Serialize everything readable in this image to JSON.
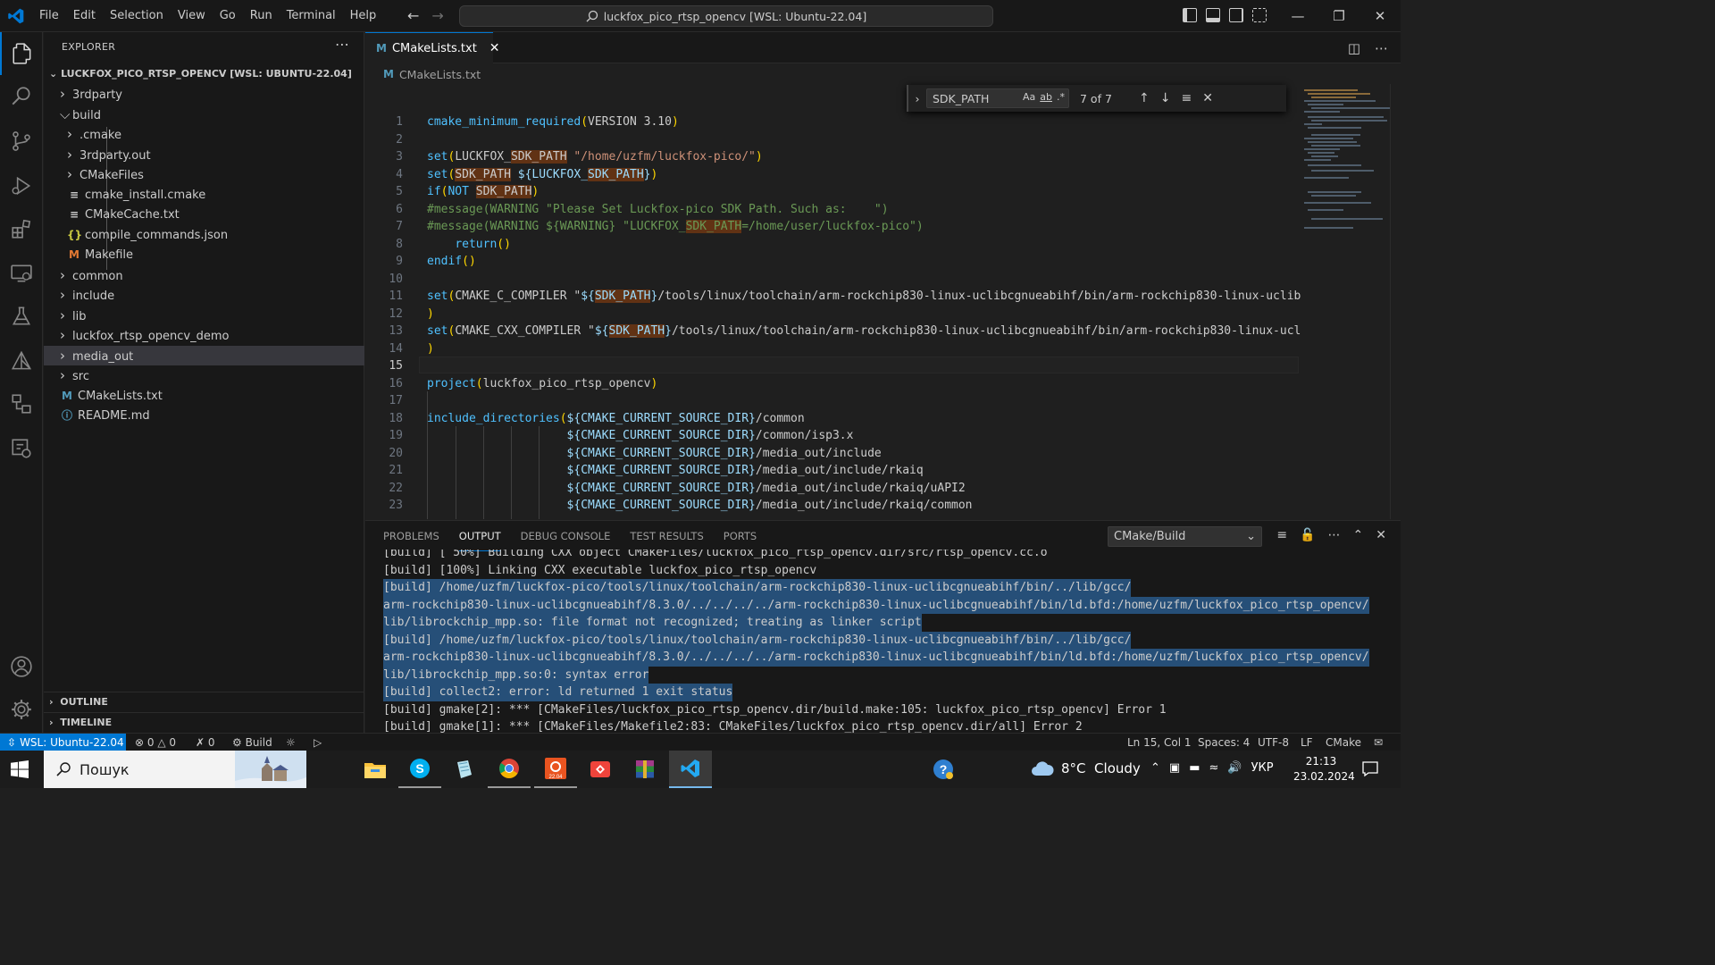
{
  "titlebar": {
    "menu": [
      "File",
      "Edit",
      "Selection",
      "View",
      "Go",
      "Run",
      "Terminal",
      "Help"
    ],
    "command_center": "luckfox_pico_rtsp_opencv [WSL: Ubuntu-22.04]",
    "window_buttons": [
      "minimize-icon",
      "restore-icon",
      "close-icon"
    ]
  },
  "explorer": {
    "title": "EXPLORER",
    "root": "LUCKFOX_PICO_RTSP_OPENCV [WSL: UBUNTU-22.04]",
    "items": [
      {
        "label": "3rdparty",
        "kind": "folder",
        "depth": 0,
        "expanded": false
      },
      {
        "label": "build",
        "kind": "folder",
        "depth": 0,
        "expanded": true
      },
      {
        "label": ".cmake",
        "kind": "folder",
        "depth": 1,
        "expanded": false
      },
      {
        "label": "3rdparty.out",
        "kind": "folder",
        "depth": 1,
        "expanded": false
      },
      {
        "label": "CMakeFiles",
        "kind": "folder",
        "depth": 1,
        "expanded": false
      },
      {
        "label": "cmake_install.cmake",
        "kind": "lines",
        "depth": 1
      },
      {
        "label": "CMakeCache.txt",
        "kind": "lines",
        "depth": 1
      },
      {
        "label": "compile_commands.json",
        "kind": "json",
        "depth": 1
      },
      {
        "label": "Makefile",
        "kind": "makefile",
        "depth": 1
      },
      {
        "label": "common",
        "kind": "folder",
        "depth": 0,
        "expanded": false
      },
      {
        "label": "include",
        "kind": "folder",
        "depth": 0,
        "expanded": false
      },
      {
        "label": "lib",
        "kind": "folder",
        "depth": 0,
        "expanded": false
      },
      {
        "label": "luckfox_rtsp_opencv_demo",
        "kind": "folder",
        "depth": 0,
        "expanded": false
      },
      {
        "label": "media_out",
        "kind": "folder",
        "depth": 0,
        "expanded": false,
        "selected": true
      },
      {
        "label": "src",
        "kind": "folder",
        "depth": 0,
        "expanded": false
      },
      {
        "label": "CMakeLists.txt",
        "kind": "cmake",
        "depth": 0
      },
      {
        "label": "README.md",
        "kind": "info",
        "depth": 0
      }
    ],
    "outline": "OUTLINE",
    "timeline": "TIMELINE"
  },
  "editor": {
    "tab_label": "CMakeLists.txt",
    "breadcrumb": "CMakeLists.txt",
    "find": {
      "query": "SDK_PATH",
      "options": [
        "Aa",
        "ab",
        ".*"
      ],
      "count": "7 of 7"
    },
    "current_line": 15,
    "line_numbers": [
      "1",
      "2",
      "3",
      "4",
      "5",
      "6",
      "7",
      "8",
      "9",
      "10",
      "11",
      "12",
      "13",
      "14",
      "15",
      "16",
      "17",
      "18",
      "19",
      "20",
      "21",
      "22",
      "23"
    ],
    "lines": [
      "cmake_minimum_required(VERSION 3.10)",
      "",
      "set(LUCKFOX_SDK_PATH \"/home/uzfm/luckfox-pico/\")",
      "set(SDK_PATH ${LUCKFOX_SDK_PATH})",
      "if(NOT SDK_PATH)",
      "#message(WARNING \"Please Set Luckfox-pico SDK Path. Such as:    \")",
      "#message(WARNING ${WARNING} \"LUCKFOX_SDK_PATH=/home/user/luckfox-pico\")",
      "    return()",
      "endif()",
      "",
      "set(CMAKE_C_COMPILER \"${SDK_PATH}/tools/linux/toolchain/arm-rockchip830-linux-uclibcgnueabihf/bin/arm-rockchip830-linux-uclib",
      ")",
      "set(CMAKE_CXX_COMPILER \"${SDK_PATH}/tools/linux/toolchain/arm-rockchip830-linux-uclibcgnueabihf/bin/arm-rockchip830-linux-ucl",
      ")",
      "",
      "project(luckfox_pico_rtsp_opencv)",
      "",
      "include_directories(${CMAKE_CURRENT_SOURCE_DIR}/common",
      "                    ${CMAKE_CURRENT_SOURCE_DIR}/common/isp3.x",
      "                    ${CMAKE_CURRENT_SOURCE_DIR}/media_out/include",
      "                    ${CMAKE_CURRENT_SOURCE_DIR}/media_out/include/rkaiq",
      "                    ${CMAKE_CURRENT_SOURCE_DIR}/media_out/include/rkaiq/uAPI2",
      "                    ${CMAKE_CURRENT_SOURCE_DIR}/media_out/include/rkaiq/common"
    ]
  },
  "panel": {
    "tabs": [
      "PROBLEMS",
      "OUTPUT",
      "DEBUG CONSOLE",
      "TEST RESULTS",
      "PORTS"
    ],
    "active_tab": "OUTPUT",
    "channel": "CMake/Build",
    "output": [
      {
        "text": "[build] [ 50%] Building CXX object CMakeFiles/luckfox_pico_rtsp_opencv.dir/src/rtsp_opencv.cc.o",
        "sel": false
      },
      {
        "text": "[build] [100%] Linking CXX executable luckfox_pico_rtsp_opencv",
        "sel": false
      },
      {
        "text": "[build] /home/uzfm/luckfox-pico/tools/linux/toolchain/arm-rockchip830-linux-uclibcgnueabihf/bin/../lib/gcc/",
        "sel": true
      },
      {
        "text": "arm-rockchip830-linux-uclibcgnueabihf/8.3.0/../../../../arm-rockchip830-linux-uclibcgnueabihf/bin/ld.bfd:/home/uzfm/luckfox_pico_rtsp_opencv/",
        "sel": true
      },
      {
        "text": "lib/librockchip_mpp.so: file format not recognized; treating as linker script",
        "sel": true
      },
      {
        "text": "[build] /home/uzfm/luckfox-pico/tools/linux/toolchain/arm-rockchip830-linux-uclibcgnueabihf/bin/../lib/gcc/",
        "sel": true
      },
      {
        "text": "arm-rockchip830-linux-uclibcgnueabihf/8.3.0/../../../../arm-rockchip830-linux-uclibcgnueabihf/bin/ld.bfd:/home/uzfm/luckfox_pico_rtsp_opencv/",
        "sel": true
      },
      {
        "text": "lib/librockchip_mpp.so:0: syntax error",
        "sel": true
      },
      {
        "text": "[build] collect2: error: ld returned 1 exit status",
        "sel": true
      },
      {
        "text": "[build] gmake[2]: *** [CMakeFiles/luckfox_pico_rtsp_opencv.dir/build.make:105: luckfox_pico_rtsp_opencv] Error 1",
        "sel": false
      },
      {
        "text": "[build] gmake[1]: *** [CMakeFiles/Makefile2:83: CMakeFiles/luckfox_pico_rtsp_opencv.dir/all] Error 2",
        "sel": false
      }
    ]
  },
  "statusbar": {
    "remote": "WSL: Ubuntu-22.04",
    "errors": "0",
    "warnings": "0",
    "ports": "0",
    "build": "Build",
    "position": "Ln 15, Col 1",
    "spaces": "Spaces: 4",
    "encoding": "UTF-8",
    "eol": "LF",
    "language": "CMake"
  },
  "taskbar": {
    "search_placeholder": "Пошук",
    "apps": [
      "file-explorer-icon",
      "skype-icon",
      "notepad-icon",
      "chrome-icon",
      "ubuntu-icon",
      "anydesk-icon",
      "winrar-icon",
      "vscode-icon"
    ],
    "weather": "8°C  Cloudy",
    "language": "УКР",
    "time": "21:13",
    "date": "23.02.2024",
    "colors": {
      "accent": "#0078d4",
      "ubuntu": "#e95420",
      "anydesk": "#ef443b",
      "vscode": "#007acc"
    }
  }
}
